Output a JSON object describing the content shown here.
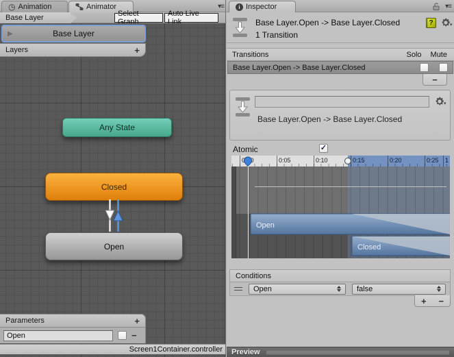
{
  "icons": {
    "clock": "◷",
    "foldout": "▶",
    "pane_menu": "▾≡",
    "check": "✓",
    "info": "i",
    "help": "?",
    "gear_caret": "▾"
  },
  "colors": {
    "selection_blue": "#7b9fd8",
    "node_teal": "#5fc3a6",
    "node_orange": "#f59b23",
    "node_gray": "#b5b5b5",
    "timeline_blue": "#7392c2",
    "transition_white_arrow": "#f2f2f2",
    "transition_blue_arrow": "#5f97e0"
  },
  "animator": {
    "tab_animation": "Animation",
    "tab_animator": "Animator",
    "breadcrumb": "Base Layer",
    "btn_select_graph": "Select Graph",
    "btn_auto_live_link": "Auto Live Link",
    "layer_name": "Base Layer",
    "layers_header": "Layers",
    "layers_add": "+",
    "node_any_state": "Any State",
    "node_closed": "Closed",
    "node_open": "Open",
    "parameters_header": "Parameters",
    "parameters_add": "+",
    "parameter_name": "Open",
    "parameter_remove": "−",
    "status": "Screen1Container.controller"
  },
  "inspector": {
    "tab": "Inspector",
    "title": "Base Layer.Open -> Base Layer.Closed",
    "subtitle": "1 Transition",
    "transitions_header": "Transitions",
    "solo": "Solo",
    "mute": "Mute",
    "transition_row": "Base Layer.Open -> Base Layer.Closed",
    "transitions_remove": "−",
    "detail_name_value": "",
    "detail_label": "Base Layer.Open -> Base Layer.Closed",
    "atomic_label": "Atomic",
    "ticks": [
      "0:00",
      "0:05",
      "0:10",
      "0:15",
      "0:20",
      "0:25",
      "1"
    ],
    "track_open": "Open",
    "track_closed": "Closed",
    "conditions_header": "Conditions",
    "condition_param": "Open",
    "condition_value": "false",
    "conditions_add": "+",
    "conditions_remove": "−",
    "preview": "Preview"
  }
}
